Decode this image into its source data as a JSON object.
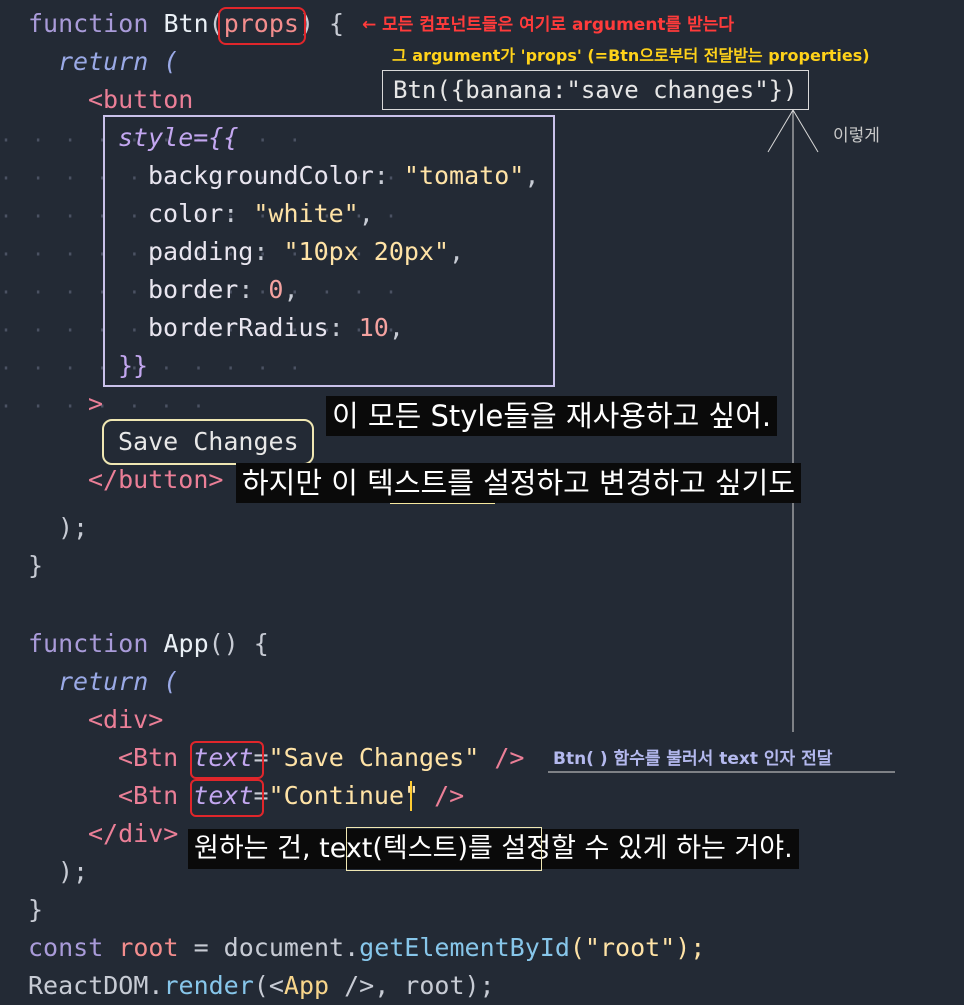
{
  "code": {
    "l1_fn": "function ",
    "l1_name": "Btn",
    "l1_param": "props",
    "l2": "return (",
    "l3": "<button",
    "l4": "style={{",
    "l5_key": "backgroundColor",
    "l5_val": "\"tomato\"",
    "l6_key": "color",
    "l6_val": "\"white\"",
    "l7_key": "padding",
    "l7_val": "\"10px 20px\"",
    "l8_key": "border",
    "l8_val": "0",
    "l9_key": "borderRadius",
    "l9_val": "10",
    "l10": "}}",
    "l11": ">",
    "l12": "Save Changes",
    "l13": "</button>",
    "l14": ");",
    "l15": "}",
    "l16_fn": "function ",
    "l16_name": "App",
    "l16_rest": "() {",
    "l17": "return (",
    "l18": "<div>",
    "l19_tag": "<Btn ",
    "l19_attr": "text",
    "l19_val": "\"Save Changes\"",
    "l19_end": " />",
    "l20_tag": "<Btn ",
    "l20_attr": "text",
    "l20_val": "\"Continue\"",
    "l20_end": " />",
    "l21": "</div>",
    "l22": ");",
    "l23": "}",
    "l24_const": "const ",
    "l24_var": "root",
    "l24_eq": " = document.",
    "l24_meth": "getElementById",
    "l24_arg": "(\"root\");",
    "l25_obj": "ReactDOM.",
    "l25_meth": "render",
    "l25_rest_open": "(<",
    "l25_comp": "App",
    "l25_rest_close": " />, root);"
  },
  "annotations": {
    "arrow_red": "← 모든 컴포넌트들은 여기로 argument를 받는다",
    "line2_yellow": "그 argument가 'props' (=Btn으로부터 전달받는 properties)",
    "example_call": "Btn({banana:\"save changes\"})",
    "like_this": "이렇게",
    "call_note": "Btn( ) 함수를 불러서 text 인자 전달"
  },
  "subtitles": {
    "s1": "이 모든 Style들을 재사용하고 싶어.",
    "s2": "하지만 이 텍스트를 설정하고 변경하고 싶기도",
    "s3": "원하는 건, text(텍스트)를 설정할 수 있게 하는 거야."
  },
  "colors": {
    "background": "#232a35",
    "red_box": "#e0262b",
    "lavender_box": "#c9c1ea",
    "annotation_red": "#ff3b3b",
    "annotation_yellow": "#ffd21a"
  }
}
